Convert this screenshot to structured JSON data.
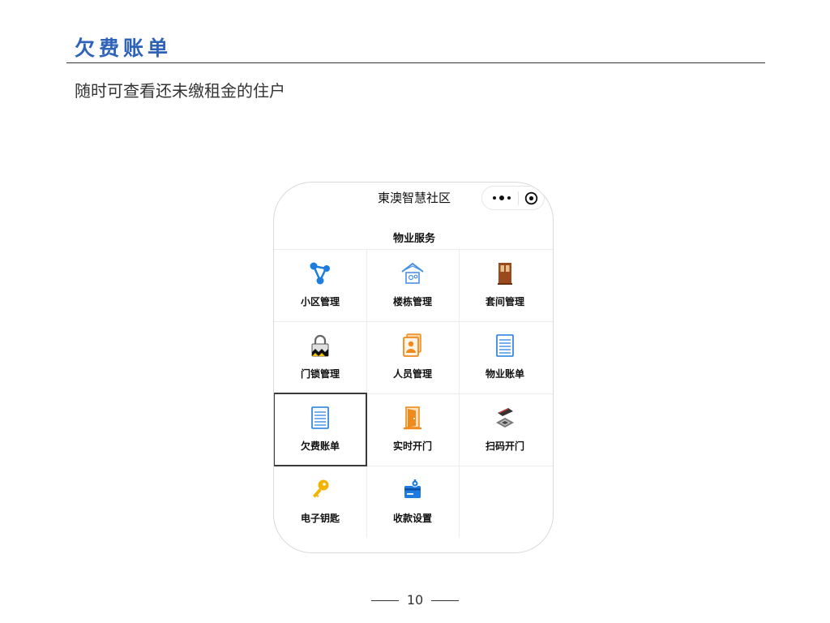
{
  "slide": {
    "title": "欠费账单",
    "subtitle": "随时可查看还未缴租金的住户",
    "page_number": "10"
  },
  "miniapp": {
    "title": "東澳智慧社区",
    "section_header": "物业服务",
    "selected_item": "欠费账单",
    "items": [
      {
        "label": "小区管理",
        "icon": "network-nodes-icon"
      },
      {
        "label": "楼栋管理",
        "icon": "building-icon"
      },
      {
        "label": "套间管理",
        "icon": "door-icon"
      },
      {
        "label": "门锁管理",
        "icon": "padlock-icon"
      },
      {
        "label": "人员管理",
        "icon": "person-card-icon"
      },
      {
        "label": "物业账单",
        "icon": "list-document-icon"
      },
      {
        "label": "欠费账单",
        "icon": "list-document-icon"
      },
      {
        "label": "实时开门",
        "icon": "open-door-icon"
      },
      {
        "label": "扫码开门",
        "icon": "qr-scan-icon"
      },
      {
        "label": "电子钥匙",
        "icon": "key-icon"
      },
      {
        "label": "收款设置",
        "icon": "payment-settings-icon"
      }
    ]
  },
  "colors": {
    "title_blue": "#2f63b8",
    "icon_blue": "#1e7be0",
    "icon_orange": "#f08a1c",
    "icon_brown": "#9a4a1c",
    "key_yellow": "#f2b400"
  }
}
